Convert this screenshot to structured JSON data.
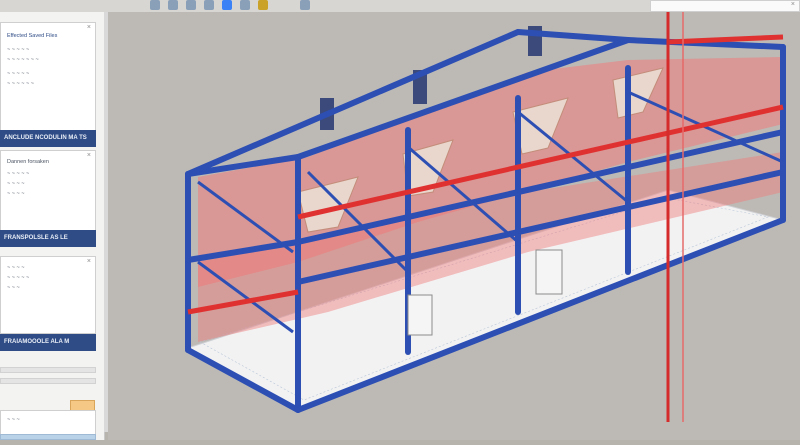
{
  "sidebar": {
    "panel1": {
      "lines": [
        "Effected Saved Files",
        "~ ~ ~ ~ ~",
        "~ ~ ~ ~ ~ ~ ~",
        "~ ~ ~ ~ ~",
        "~ ~ ~ ~ ~ ~"
      ],
      "close": "×"
    },
    "bar1": "ANCLUDE NCODULIN MA TS",
    "panel2": {
      "lines": [
        "Dannen forsaken",
        "~ ~ ~ ~ ~",
        "~ ~ ~ ~",
        "~ ~ ~ ~"
      ],
      "close": "×"
    },
    "bar2": "FRANSPOLSLE AS LE",
    "panel3": {
      "lines": [
        "~ ~ ~ ~",
        "~ ~ ~ ~ ~",
        "~ ~ ~"
      ],
      "close": "×"
    },
    "bar3": "FRAIAMOOOLE ALA M"
  },
  "toolbar": {
    "icons": [
      "file-icon",
      "edit-icon",
      "view-icon",
      "snap-icon",
      "shape-icon",
      "render-icon",
      "measure-icon",
      "settings-icon"
    ]
  },
  "colors": {
    "frame_blue": "#2d4fb4",
    "brace_red": "#e03131",
    "hopper": "#e9d6cc",
    "panel_bar": "#2f4c86"
  },
  "viewport": {
    "model": "3D steel frame structure with hoppers"
  }
}
